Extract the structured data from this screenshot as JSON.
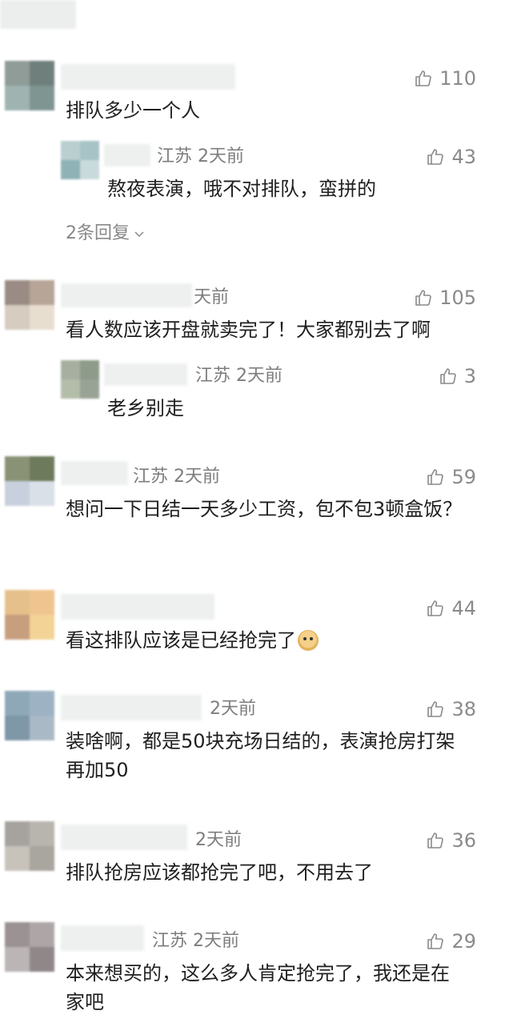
{
  "comments": [
    {
      "meta": "",
      "likes": "110",
      "text": "排队多少一个人",
      "replies": [
        {
          "meta": "江苏 2天前",
          "likes": "43",
          "text": "熬夜表演，哦不对排队，蛮拼的"
        }
      ],
      "more_replies": "2条回复"
    },
    {
      "meta": "天前",
      "likes": "105",
      "text": "看人数应该开盘就卖完了！大家都别去了啊",
      "replies": [
        {
          "meta": "江苏 2天前",
          "likes": "3",
          "text": "老乡别走"
        }
      ]
    },
    {
      "meta": "江苏 2天前",
      "likes": "59",
      "text": "想问一下日结一天多少工资，包不包3顿盒饭？"
    },
    {
      "meta": "",
      "likes": "44",
      "text": "看这排队应该是已经抢完了"
    },
    {
      "meta": "2天前",
      "likes": "38",
      "text": "装啥啊，都是50块充场日结的，表演抢房打架再加50"
    },
    {
      "meta": "2天前",
      "likes": "36",
      "text": "排队抢房应该都抢完了吧，不用去了"
    },
    {
      "meta": "江苏 2天前",
      "likes": "29",
      "text": "本来想买的，这么多人肯定抢完了，我还是在家吧"
    }
  ],
  "icons": {
    "like": "thumbs-up-icon",
    "chevron": "chevron-down-icon",
    "emoji": "dog-emoji-icon"
  },
  "colors": {
    "text": "#1f1f1f",
    "meta": "#7d7d7d",
    "background": "#ffffff"
  }
}
